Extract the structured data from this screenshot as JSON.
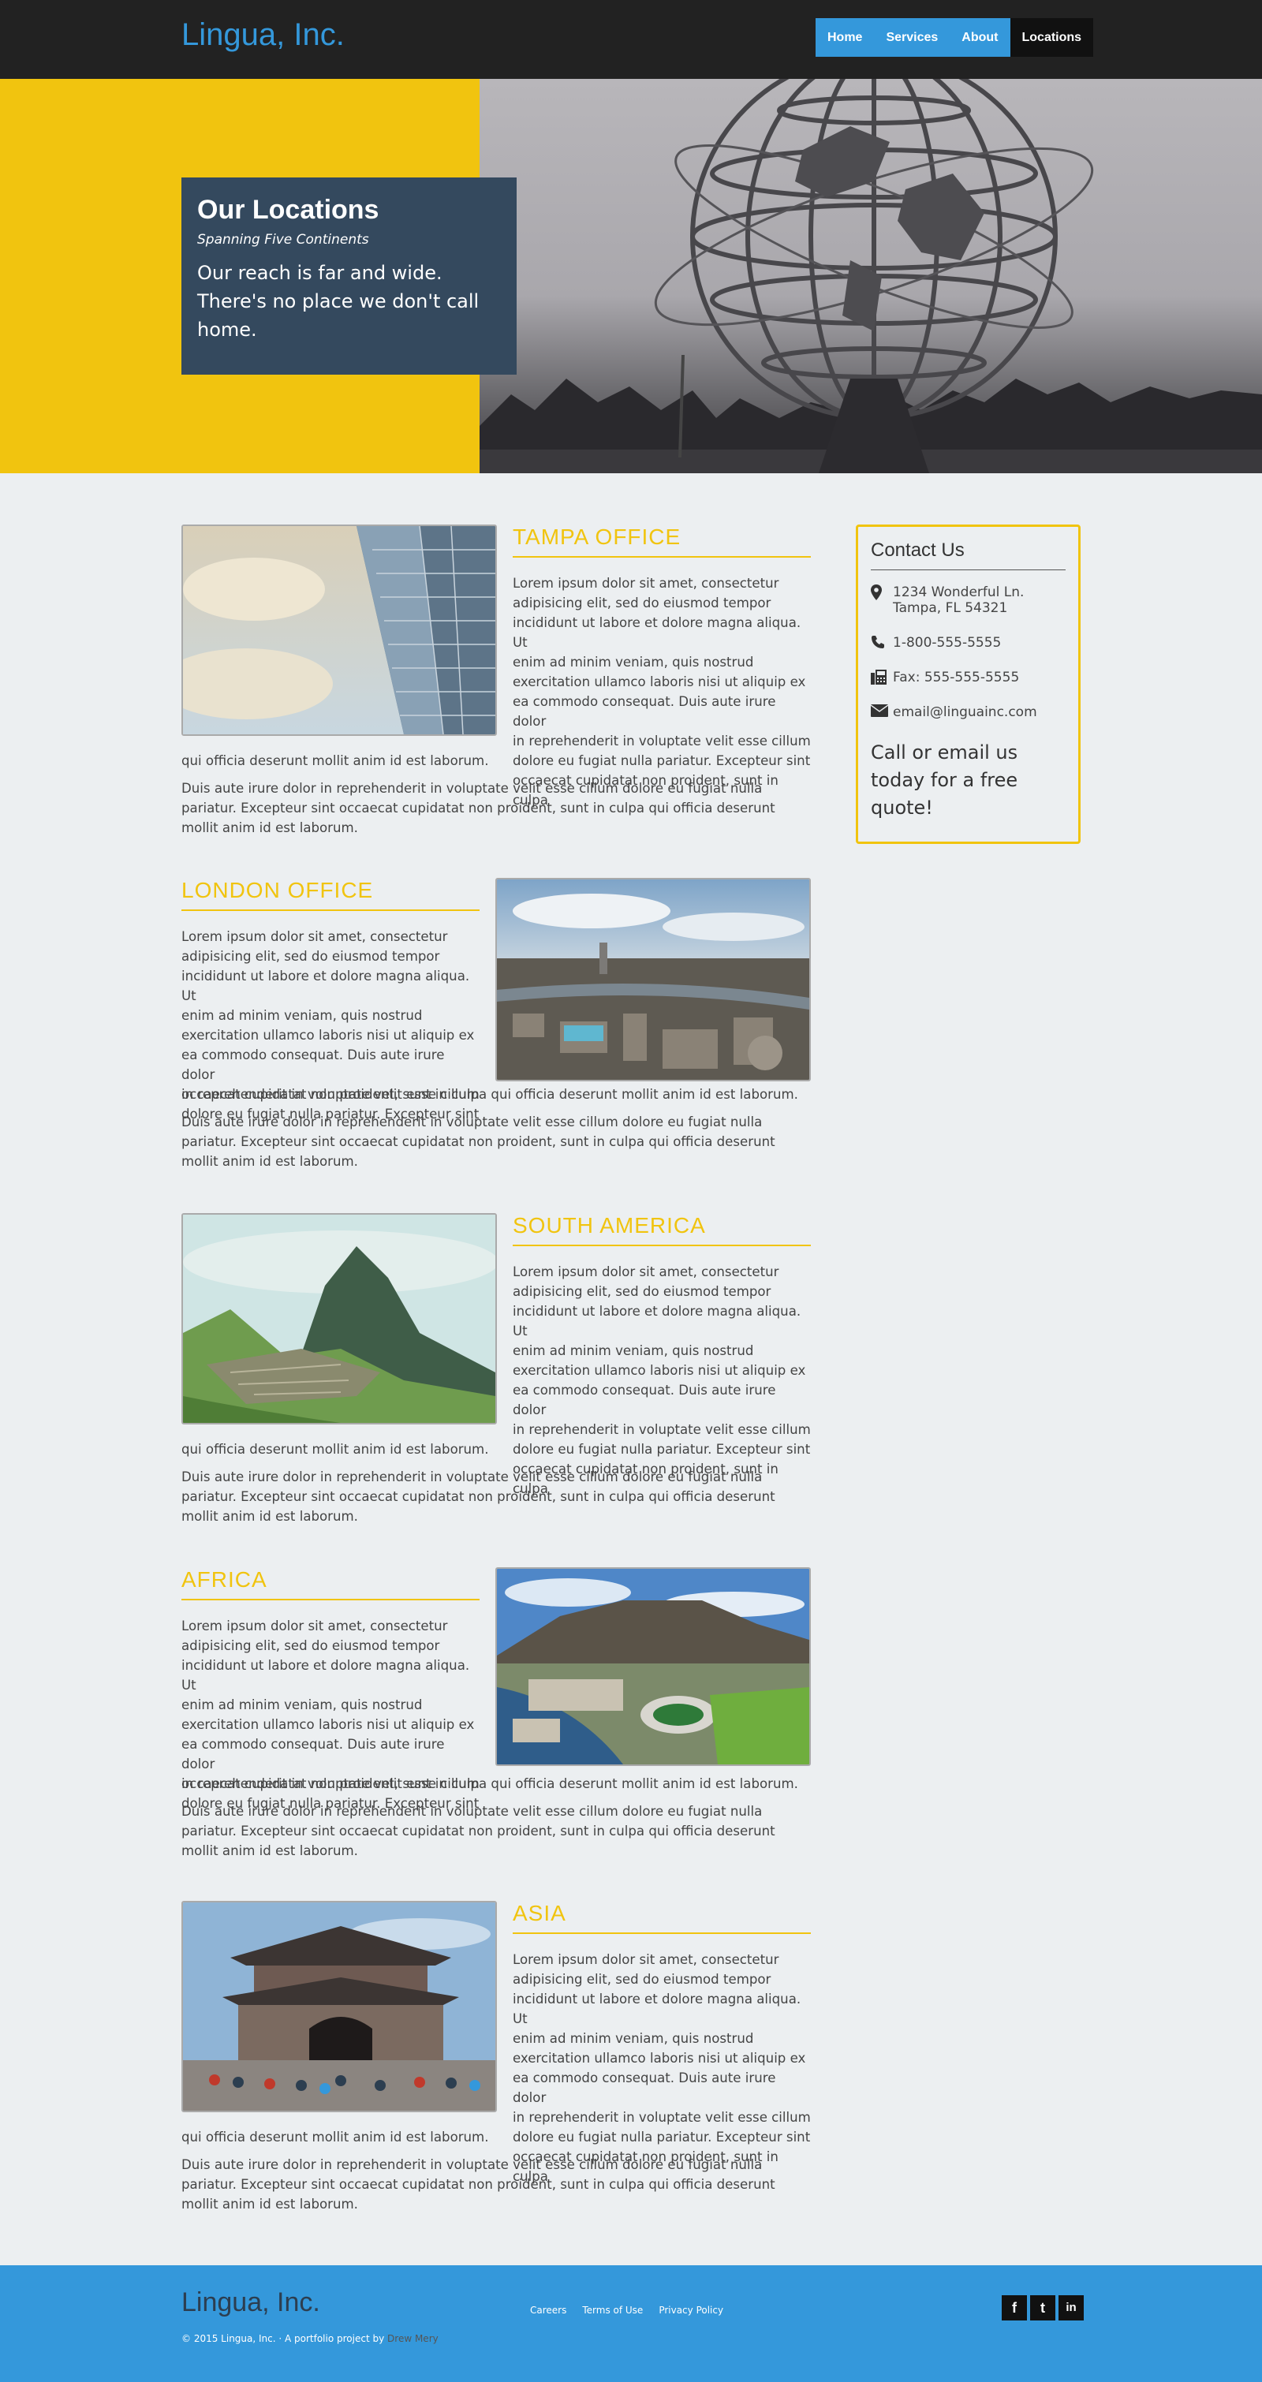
{
  "header": {
    "brand": "Lingua, Inc.",
    "nav": [
      {
        "label": "Home",
        "active": false
      },
      {
        "label": "Services",
        "active": false
      },
      {
        "label": "About",
        "active": false
      },
      {
        "label": "Locations",
        "active": true
      }
    ]
  },
  "hero": {
    "title": "Our Locations",
    "subtitle": "Spanning Five Continents",
    "text": "Our reach is far and wide. There's no place we don't call home."
  },
  "offices": [
    {
      "title": "TAMPA OFFICE",
      "para1_lines": [
        "Lorem ipsum dolor sit amet, consectetur",
        "adipisicing elit, sed do eiusmod tempor",
        "incididunt ut labore et dolore magna aliqua. Ut",
        "enim ad minim veniam, quis nostrud",
        "exercitation ullamco laboris nisi ut aliquip ex",
        "ea commodo consequat. Duis aute irure dolor",
        "in reprehenderit in voluptate velit esse cillum",
        "dolore eu fugiat nulla pariatur. Excepteur sint",
        "occaecat cupidatat non proident, sunt in culpa"
      ],
      "para1_tail": "qui officia deserunt mollit anim id est laborum.",
      "para2": "Duis aute irure dolor in reprehenderit in voluptate velit esse cillum dolore eu fugiat nulla pariatur. Excepteur sint occaecat cupidatat non proident, sunt in culpa qui officia deserunt mollit anim id est laborum."
    },
    {
      "title": "LONDON OFFICE",
      "para1_lines": [
        "Lorem ipsum dolor sit amet, consectetur",
        "adipisicing elit, sed do eiusmod tempor",
        "incididunt ut labore et dolore magna aliqua. Ut",
        "enim ad minim veniam, quis nostrud",
        "exercitation ullamco laboris nisi ut aliquip ex",
        "ea commodo consequat. Duis aute irure dolor",
        "in reprehenderit in voluptate velit esse cillum",
        "dolore eu fugiat nulla pariatur. Excepteur sint"
      ],
      "para1_tail": "occaecat cupidatat non proident, sunt in culpa qui officia deserunt mollit anim id est laborum.",
      "para2": "Duis aute irure dolor in reprehenderit in voluptate velit esse cillum dolore eu fugiat nulla pariatur. Excepteur sint occaecat cupidatat non proident, sunt in culpa qui officia deserunt mollit anim id est laborum."
    },
    {
      "title": "SOUTH AMERICA",
      "para1_lines": [
        "Lorem ipsum dolor sit amet, consectetur",
        "adipisicing elit, sed do eiusmod tempor",
        "incididunt ut labore et dolore magna aliqua. Ut",
        "enim ad minim veniam, quis nostrud",
        "exercitation ullamco laboris nisi ut aliquip ex",
        "ea commodo consequat. Duis aute irure dolor",
        "in reprehenderit in voluptate velit esse cillum",
        "dolore eu fugiat nulla pariatur. Excepteur sint",
        "occaecat cupidatat non proident, sunt in culpa"
      ],
      "para1_tail": "qui officia deserunt mollit anim id est laborum.",
      "para2": "Duis aute irure dolor in reprehenderit in voluptate velit esse cillum dolore eu fugiat nulla pariatur. Excepteur sint occaecat cupidatat non proident, sunt in culpa qui officia deserunt mollit anim id est laborum."
    },
    {
      "title": "AFRICA",
      "para1_lines": [
        "Lorem ipsum dolor sit amet, consectetur",
        "adipisicing elit, sed do eiusmod tempor",
        "incididunt ut labore et dolore magna aliqua. Ut",
        "enim ad minim veniam, quis nostrud",
        "exercitation ullamco laboris nisi ut aliquip ex",
        "ea commodo consequat. Duis aute irure dolor",
        "in reprehenderit in voluptate velit esse cillum",
        "dolore eu fugiat nulla pariatur. Excepteur sint"
      ],
      "para1_tail": "occaecat cupidatat non proident, sunt in culpa qui officia deserunt mollit anim id est laborum.",
      "para2": "Duis aute irure dolor in reprehenderit in voluptate velit esse cillum dolore eu fugiat nulla pariatur. Excepteur sint occaecat cupidatat non proident, sunt in culpa qui officia deserunt mollit anim id est laborum."
    },
    {
      "title": "ASIA",
      "para1_lines": [
        "Lorem ipsum dolor sit amet, consectetur",
        "adipisicing elit, sed do eiusmod tempor",
        "incididunt ut labore et dolore magna aliqua. Ut",
        "enim ad minim veniam, quis nostrud",
        "exercitation ullamco laboris nisi ut aliquip ex",
        "ea commodo consequat. Duis aute irure dolor",
        "in reprehenderit in voluptate velit esse cillum",
        "dolore eu fugiat nulla pariatur. Excepteur sint",
        "occaecat cupidatat non proident, sunt in culpa"
      ],
      "para1_tail": "qui officia deserunt mollit anim id est laborum.",
      "para2": "Duis aute irure dolor in reprehenderit in voluptate velit esse cillum dolore eu fugiat nulla pariatur. Excepteur sint occaecat cupidatat non proident, sunt in culpa qui officia deserunt mollit anim id est laborum."
    }
  ],
  "contact": {
    "title": "Contact Us",
    "address_line1": "1234 Wonderful Ln.",
    "address_line2": "Tampa, FL 54321",
    "phone": "1-800-555-5555",
    "fax": "Fax: 555-555-5555",
    "email": "email@linguainc.com",
    "call_to_action": "Call or email us today for a free quote!",
    "icons": [
      "map-marker-icon",
      "phone-icon",
      "fax-icon",
      "envelope-icon"
    ]
  },
  "footer": {
    "brand": "Lingua, Inc.",
    "copyright": "© 2015 Lingua, Inc. · A portfolio project by",
    "author": "Drew Mery",
    "links": [
      "Careers",
      "Terms of Use",
      "Privacy Policy"
    ],
    "social": [
      {
        "icon": "facebook-icon",
        "glyph": "f"
      },
      {
        "icon": "twitter-icon",
        "glyph": "t"
      },
      {
        "icon": "linkedin-icon",
        "glyph": "in"
      }
    ]
  },
  "colors": {
    "accent_blue": "#3498db",
    "accent_yellow": "#f1c40f",
    "dark_navy": "#34495e",
    "nav_dark": "#222222"
  }
}
